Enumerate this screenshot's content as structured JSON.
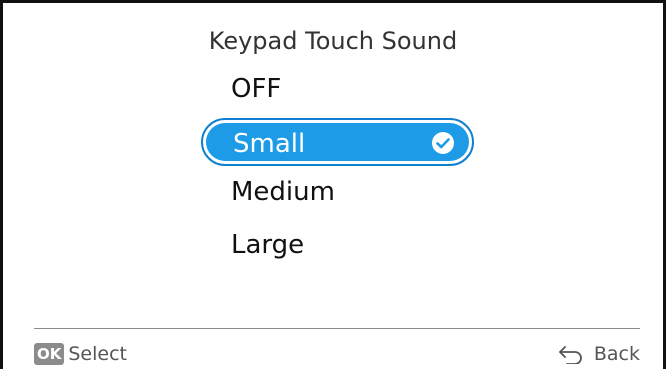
{
  "screen": {
    "title": "Keypad Touch Sound"
  },
  "options": {
    "items": [
      {
        "label": "OFF",
        "selected": false
      },
      {
        "label": "Small",
        "selected": true
      },
      {
        "label": "Medium",
        "selected": false
      },
      {
        "label": "Large",
        "selected": false
      }
    ]
  },
  "footer": {
    "ok_badge": "OK",
    "select_label": "Select",
    "back_label": "Back",
    "back_icon": "back-arrow-icon"
  },
  "colors": {
    "accent": "#1e9be6",
    "accent_border": "#0f7fd0",
    "frame": "#111111"
  }
}
